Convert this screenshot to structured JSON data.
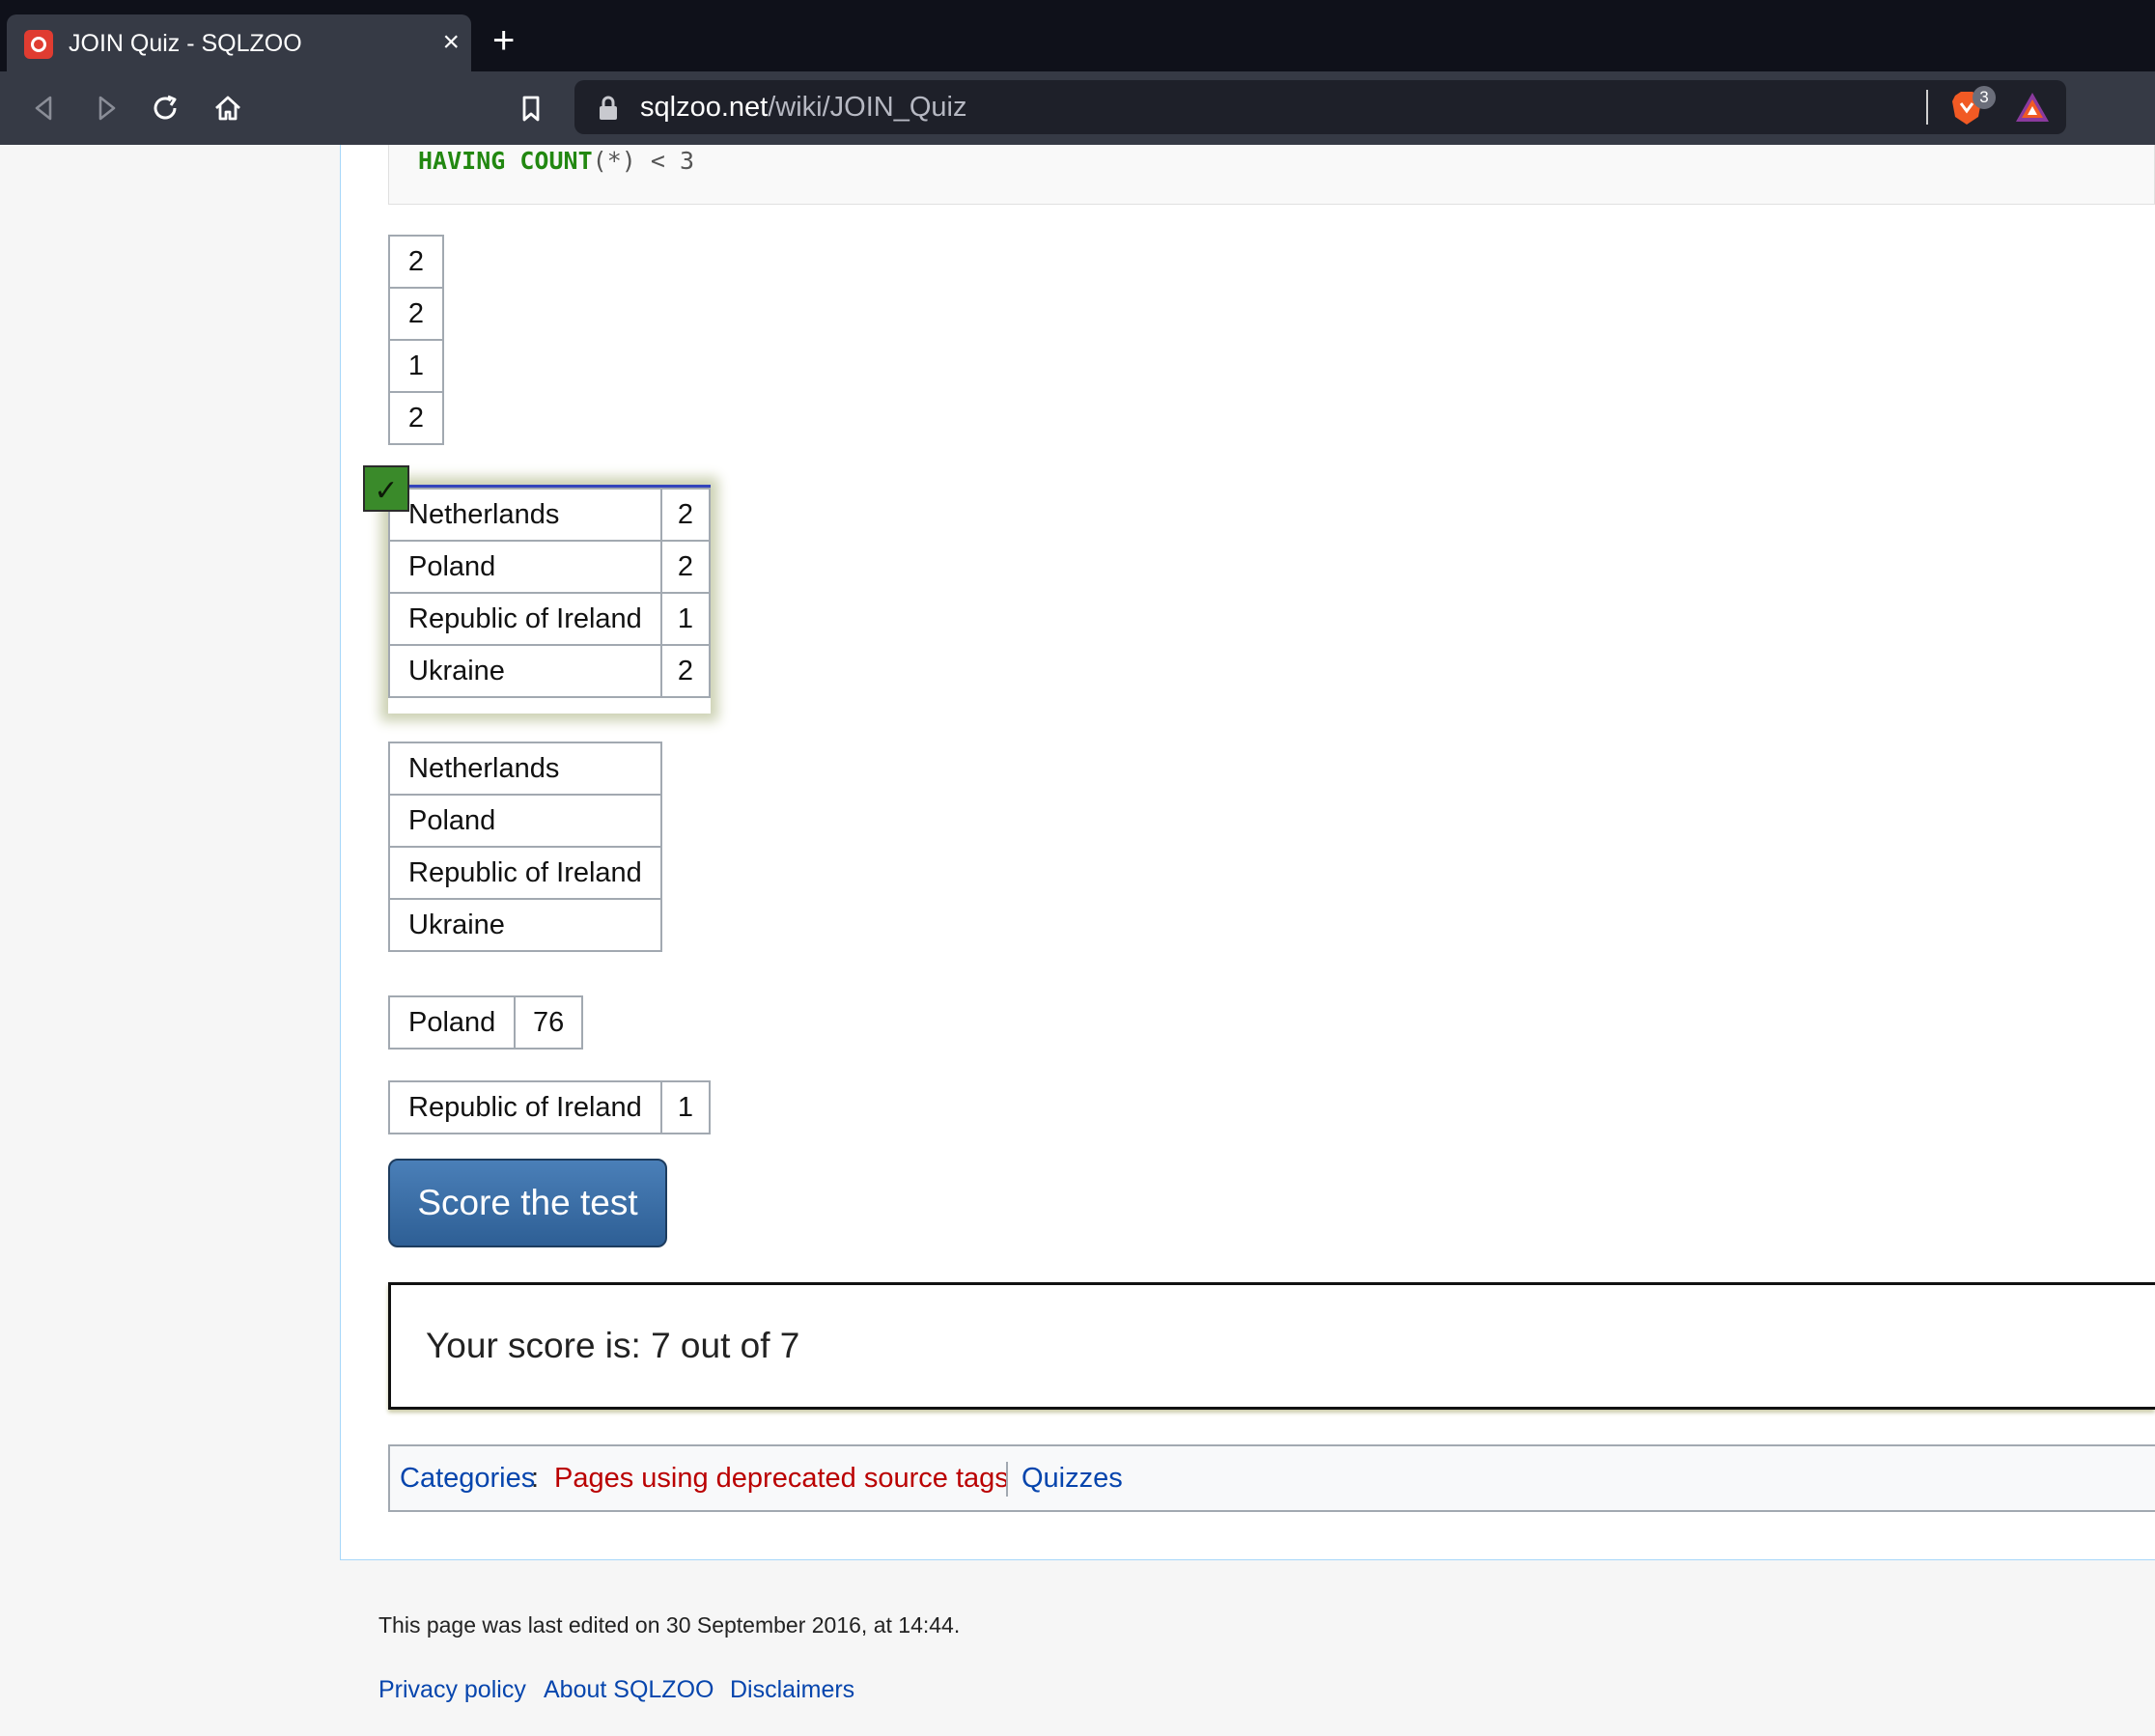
{
  "browser": {
    "tab_title": "JOIN Quiz - SQLZOO",
    "new_tab": "+",
    "close": "×",
    "url_domain": "sqlzoo.net",
    "url_path": "/wiki/JOIN_Quiz",
    "shield_count": "3"
  },
  "code": {
    "kw1": "HAVING",
    "kw2": "COUNT",
    "rest": "(*) < 3"
  },
  "answers": {
    "a1": [
      "2",
      "2",
      "1",
      "2"
    ],
    "a2": [
      {
        "country": "Netherlands",
        "count": "2"
      },
      {
        "country": "Poland",
        "count": "2"
      },
      {
        "country": "Republic of Ireland",
        "count": "1"
      },
      {
        "country": "Ukraine",
        "count": "2"
      }
    ],
    "a3": [
      "Netherlands",
      "Poland",
      "Republic of Ireland",
      "Ukraine"
    ],
    "a4": {
      "country": "Poland",
      "value": "76"
    },
    "a5": {
      "country": "Republic of Ireland",
      "value": "1"
    },
    "checkmark": "✓"
  },
  "score_button": "Score the test",
  "score_text": "Your score is: 7 out of 7",
  "categories": {
    "label": "Categories",
    "colon": ":",
    "items": [
      "Pages using deprecated source tags",
      "Quizzes"
    ]
  },
  "footer": {
    "last_edited": "This page was last edited on 30 September 2016, at 14:44.",
    "links": [
      "Privacy policy",
      "About SQLZOO",
      "Disclaimers"
    ]
  }
}
